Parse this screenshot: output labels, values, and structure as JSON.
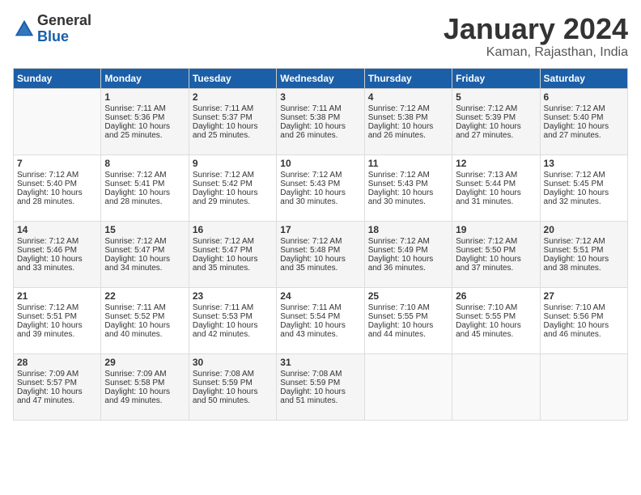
{
  "header": {
    "logo_general": "General",
    "logo_blue": "Blue",
    "month_title": "January 2024",
    "location": "Kaman, Rajasthan, India"
  },
  "days_of_week": [
    "Sunday",
    "Monday",
    "Tuesday",
    "Wednesday",
    "Thursday",
    "Friday",
    "Saturday"
  ],
  "weeks": [
    [
      {
        "day": "",
        "empty": true
      },
      {
        "day": "1",
        "sunrise": "Sunrise: 7:11 AM",
        "sunset": "Sunset: 5:36 PM",
        "daylight": "Daylight: 10 hours and 25 minutes."
      },
      {
        "day": "2",
        "sunrise": "Sunrise: 7:11 AM",
        "sunset": "Sunset: 5:37 PM",
        "daylight": "Daylight: 10 hours and 25 minutes."
      },
      {
        "day": "3",
        "sunrise": "Sunrise: 7:11 AM",
        "sunset": "Sunset: 5:38 PM",
        "daylight": "Daylight: 10 hours and 26 minutes."
      },
      {
        "day": "4",
        "sunrise": "Sunrise: 7:12 AM",
        "sunset": "Sunset: 5:38 PM",
        "daylight": "Daylight: 10 hours and 26 minutes."
      },
      {
        "day": "5",
        "sunrise": "Sunrise: 7:12 AM",
        "sunset": "Sunset: 5:39 PM",
        "daylight": "Daylight: 10 hours and 27 minutes."
      },
      {
        "day": "6",
        "sunrise": "Sunrise: 7:12 AM",
        "sunset": "Sunset: 5:40 PM",
        "daylight": "Daylight: 10 hours and 27 minutes."
      }
    ],
    [
      {
        "day": "7",
        "sunrise": "Sunrise: 7:12 AM",
        "sunset": "Sunset: 5:40 PM",
        "daylight": "Daylight: 10 hours and 28 minutes."
      },
      {
        "day": "8",
        "sunrise": "Sunrise: 7:12 AM",
        "sunset": "Sunset: 5:41 PM",
        "daylight": "Daylight: 10 hours and 28 minutes."
      },
      {
        "day": "9",
        "sunrise": "Sunrise: 7:12 AM",
        "sunset": "Sunset: 5:42 PM",
        "daylight": "Daylight: 10 hours and 29 minutes."
      },
      {
        "day": "10",
        "sunrise": "Sunrise: 7:12 AM",
        "sunset": "Sunset: 5:43 PM",
        "daylight": "Daylight: 10 hours and 30 minutes."
      },
      {
        "day": "11",
        "sunrise": "Sunrise: 7:12 AM",
        "sunset": "Sunset: 5:43 PM",
        "daylight": "Daylight: 10 hours and 30 minutes."
      },
      {
        "day": "12",
        "sunrise": "Sunrise: 7:13 AM",
        "sunset": "Sunset: 5:44 PM",
        "daylight": "Daylight: 10 hours and 31 minutes."
      },
      {
        "day": "13",
        "sunrise": "Sunrise: 7:12 AM",
        "sunset": "Sunset: 5:45 PM",
        "daylight": "Daylight: 10 hours and 32 minutes."
      }
    ],
    [
      {
        "day": "14",
        "sunrise": "Sunrise: 7:12 AM",
        "sunset": "Sunset: 5:46 PM",
        "daylight": "Daylight: 10 hours and 33 minutes."
      },
      {
        "day": "15",
        "sunrise": "Sunrise: 7:12 AM",
        "sunset": "Sunset: 5:47 PM",
        "daylight": "Daylight: 10 hours and 34 minutes."
      },
      {
        "day": "16",
        "sunrise": "Sunrise: 7:12 AM",
        "sunset": "Sunset: 5:47 PM",
        "daylight": "Daylight: 10 hours and 35 minutes."
      },
      {
        "day": "17",
        "sunrise": "Sunrise: 7:12 AM",
        "sunset": "Sunset: 5:48 PM",
        "daylight": "Daylight: 10 hours and 35 minutes."
      },
      {
        "day": "18",
        "sunrise": "Sunrise: 7:12 AM",
        "sunset": "Sunset: 5:49 PM",
        "daylight": "Daylight: 10 hours and 36 minutes."
      },
      {
        "day": "19",
        "sunrise": "Sunrise: 7:12 AM",
        "sunset": "Sunset: 5:50 PM",
        "daylight": "Daylight: 10 hours and 37 minutes."
      },
      {
        "day": "20",
        "sunrise": "Sunrise: 7:12 AM",
        "sunset": "Sunset: 5:51 PM",
        "daylight": "Daylight: 10 hours and 38 minutes."
      }
    ],
    [
      {
        "day": "21",
        "sunrise": "Sunrise: 7:12 AM",
        "sunset": "Sunset: 5:51 PM",
        "daylight": "Daylight: 10 hours and 39 minutes."
      },
      {
        "day": "22",
        "sunrise": "Sunrise: 7:11 AM",
        "sunset": "Sunset: 5:52 PM",
        "daylight": "Daylight: 10 hours and 40 minutes."
      },
      {
        "day": "23",
        "sunrise": "Sunrise: 7:11 AM",
        "sunset": "Sunset: 5:53 PM",
        "daylight": "Daylight: 10 hours and 42 minutes."
      },
      {
        "day": "24",
        "sunrise": "Sunrise: 7:11 AM",
        "sunset": "Sunset: 5:54 PM",
        "daylight": "Daylight: 10 hours and 43 minutes."
      },
      {
        "day": "25",
        "sunrise": "Sunrise: 7:10 AM",
        "sunset": "Sunset: 5:55 PM",
        "daylight": "Daylight: 10 hours and 44 minutes."
      },
      {
        "day": "26",
        "sunrise": "Sunrise: 7:10 AM",
        "sunset": "Sunset: 5:55 PM",
        "daylight": "Daylight: 10 hours and 45 minutes."
      },
      {
        "day": "27",
        "sunrise": "Sunrise: 7:10 AM",
        "sunset": "Sunset: 5:56 PM",
        "daylight": "Daylight: 10 hours and 46 minutes."
      }
    ],
    [
      {
        "day": "28",
        "sunrise": "Sunrise: 7:09 AM",
        "sunset": "Sunset: 5:57 PM",
        "daylight": "Daylight: 10 hours and 47 minutes."
      },
      {
        "day": "29",
        "sunrise": "Sunrise: 7:09 AM",
        "sunset": "Sunset: 5:58 PM",
        "daylight": "Daylight: 10 hours and 49 minutes."
      },
      {
        "day": "30",
        "sunrise": "Sunrise: 7:08 AM",
        "sunset": "Sunset: 5:59 PM",
        "daylight": "Daylight: 10 hours and 50 minutes."
      },
      {
        "day": "31",
        "sunrise": "Sunrise: 7:08 AM",
        "sunset": "Sunset: 5:59 PM",
        "daylight": "Daylight: 10 hours and 51 minutes."
      },
      {
        "day": "",
        "empty": true
      },
      {
        "day": "",
        "empty": true
      },
      {
        "day": "",
        "empty": true
      }
    ]
  ]
}
